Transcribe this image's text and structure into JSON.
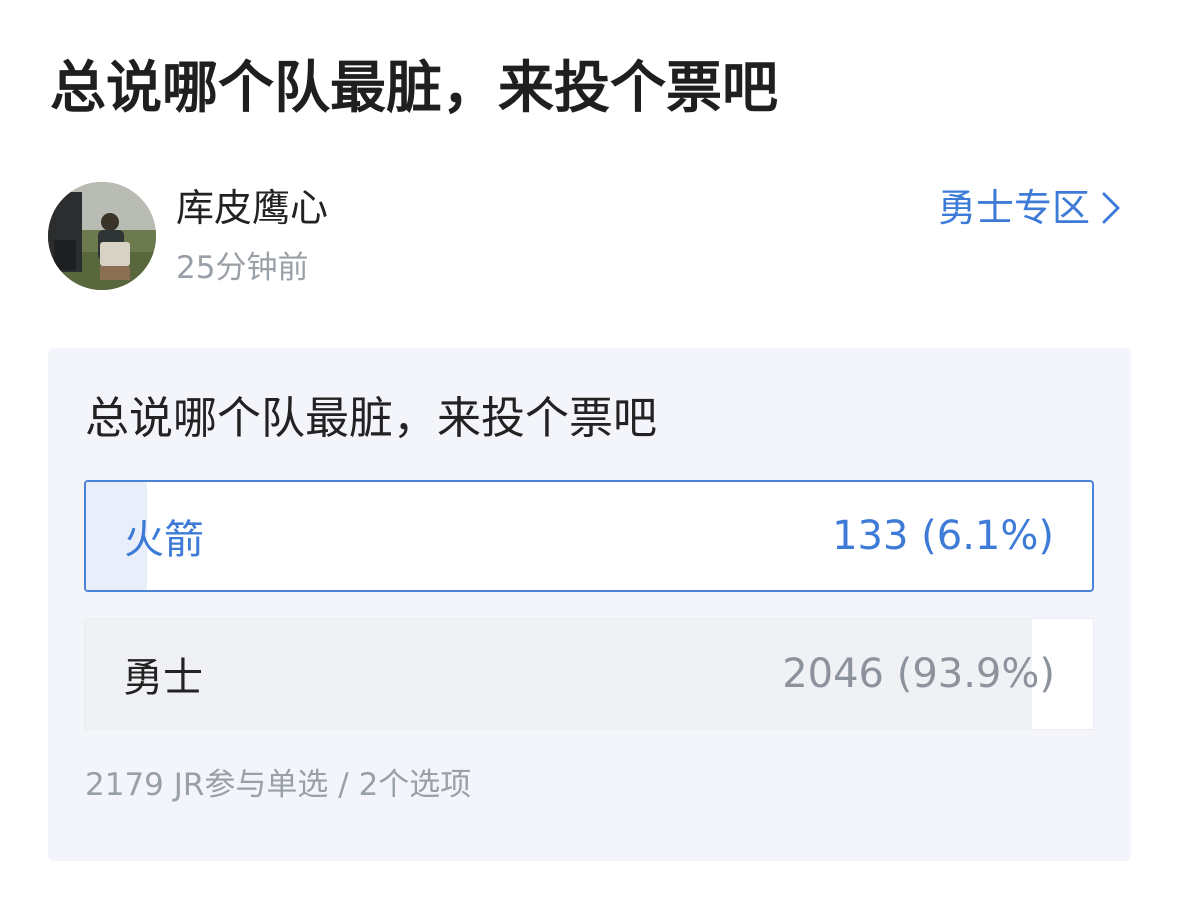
{
  "post": {
    "title": "总说哪个队最脏，来投个票吧"
  },
  "author": {
    "name": "库皮鹰心",
    "time": "25分钟前",
    "avatar_icon": "avatar-photo"
  },
  "zone_link": {
    "label": "勇士专区",
    "icon": "chevron-right-icon"
  },
  "poll": {
    "question": "总说哪个队最脏，来投个票吧",
    "options": [
      {
        "label": "火箭",
        "count_text": "133 (6.1%)",
        "votes": 133,
        "percent": 6.1,
        "selected": true
      },
      {
        "label": "勇士",
        "count_text": "2046 (93.9%)",
        "votes": 2046,
        "percent": 93.9,
        "selected": false
      }
    ],
    "summary": "2179 JR参与单选 / 2个选项"
  },
  "colors": {
    "accent": "#3e7bd6",
    "card_bg": "#f3f5fa",
    "muted_text": "#9aa0a8"
  }
}
